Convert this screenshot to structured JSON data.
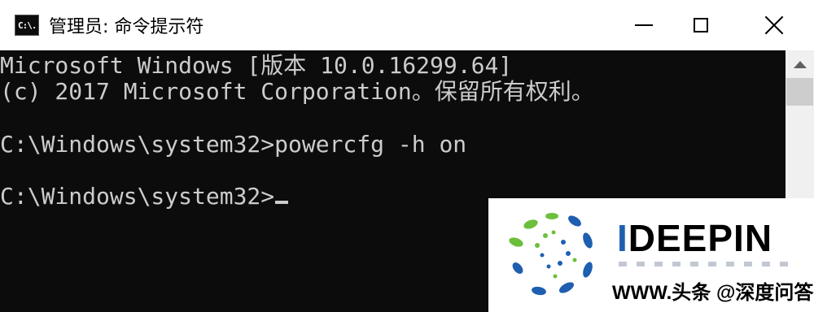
{
  "window": {
    "icon_text": "C:\\.",
    "title": "管理员: 命令提示符",
    "minimize": "minimize",
    "maximize": "maximize",
    "close": "close"
  },
  "console": {
    "lines": [
      "Microsoft Windows [版本 10.0.16299.64]",
      "(c) 2017 Microsoft Corporation。保留所有权利。",
      "C:\\Windows\\system32>powercfg -h on",
      "C:\\Windows\\system32>"
    ]
  },
  "watermark": {
    "brand_prefix": "I",
    "brand_suffix": "DEEPIN",
    "caption": "WWW.头条 @深度问答"
  },
  "colors": {
    "console_bg": "#0c0c0c",
    "console_text": "#cccccc",
    "logo_green": "#6cbf3a",
    "logo_blue": "#1e5fb0"
  }
}
